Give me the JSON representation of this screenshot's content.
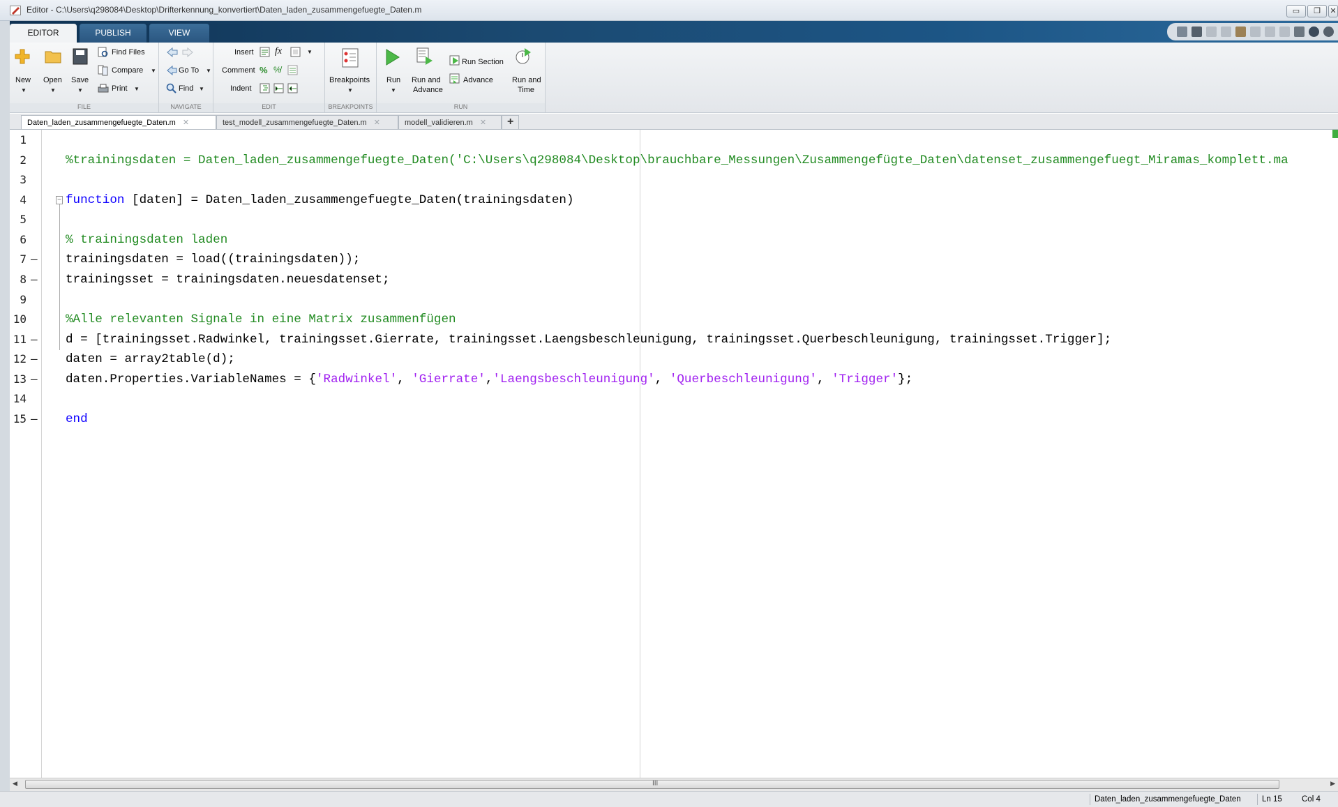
{
  "window": {
    "title": "Editor - C:\\Users\\q298084\\Desktop\\Drifterkennung_konvertiert\\Daten_laden_zusammengefuegte_Daten.m",
    "controls": [
      "minimize-icon",
      "restore-icon",
      "close-icon"
    ]
  },
  "ribbon_tabs": [
    "EDITOR",
    "PUBLISH",
    "VIEW"
  ],
  "ribbon": {
    "file": {
      "label": "FILE",
      "new": "New",
      "open": "Open",
      "save": "Save",
      "find_files": "Find Files",
      "compare": "Compare",
      "print": "Print"
    },
    "navigate": {
      "label": "NAVIGATE",
      "go_to": "Go To",
      "find": "Find"
    },
    "edit": {
      "label": "EDIT",
      "insert": "Insert",
      "comment": "Comment",
      "indent": "Indent"
    },
    "breakpoints": {
      "label": "BREAKPOINTS",
      "breakpoints": "Breakpoints"
    },
    "run": {
      "label": "RUN",
      "run": "Run",
      "run_and_advance_1": "Run and",
      "run_and_advance_2": "Advance",
      "run_section": "Run Section",
      "advance": "Advance",
      "run_and_time_1": "Run and",
      "run_and_time_2": "Time"
    }
  },
  "doc_tabs": [
    {
      "label": "Daten_laden_zusammengefuegte_Daten.m",
      "active": true
    },
    {
      "label": "test_modell_zusammengefuegte_Daten.m",
      "active": false
    },
    {
      "label": "modell_validieren.m",
      "active": false
    }
  ],
  "new_tab": "+",
  "code": {
    "line_numbers": [
      "1",
      "2",
      "3",
      "4",
      "5",
      "6",
      "7",
      "8",
      "9",
      "10",
      "11",
      "12",
      "13",
      "14",
      "15"
    ],
    "breakpoint_marks": [
      "",
      "",
      "",
      "",
      "",
      "",
      "–",
      "–",
      "",
      "",
      "–",
      "–",
      "–",
      "",
      "–"
    ],
    "l2": "%trainingsdaten = Daten_laden_zusammengefuegte_Daten('C:\\Users\\q298084\\Desktop\\brauchbare_Messungen\\Zusammengefügte_Daten\\datenset_zusammengefuegt_Miramas_komplett.ma",
    "l4_kw": "function",
    "l4_rest": " [daten] = Daten_laden_zusammengefuegte_Daten(trainingsdaten)",
    "l6": "% trainingsdaten laden",
    "l7": "trainingsdaten = load((trainingsdaten));",
    "l8": "trainingsset = trainingsdaten.neuesdatenset;",
    "l10": "%Alle relevanten Signale in eine Matrix zusammenfügen",
    "l11": "d = [trainingsset.Radwinkel, trainingsset.Gierrate, trainingsset.Laengsbeschleunigung, trainingsset.Querbeschleunigung, trainingsset.Trigger];",
    "l12": "daten = array2table(d);",
    "l13_a": "daten.Properties.VariableNames = {",
    "l13_s1": "'Radwinkel'",
    "l13_c1": ", ",
    "l13_s2": "'Gierrate'",
    "l13_c2": ",",
    "l13_s3": "'Laengsbeschleunigung'",
    "l13_c3": ", ",
    "l13_s4": "'Querbeschleunigung'",
    "l13_c4": ", ",
    "l13_s5": "'Trigger'",
    "l13_end": "};",
    "l15_kw": "end"
  },
  "scrollbar": {
    "grip": "III"
  },
  "status": {
    "function_name": "Daten_laden_zusammengefuegte_Daten",
    "ln": "Ln  15",
    "col": "Col  4"
  },
  "colors": {
    "comment": "#228b22",
    "keyword": "#0e00ff",
    "string": "#a020f0",
    "ribbon_tab_bar": "#1b4a72"
  }
}
